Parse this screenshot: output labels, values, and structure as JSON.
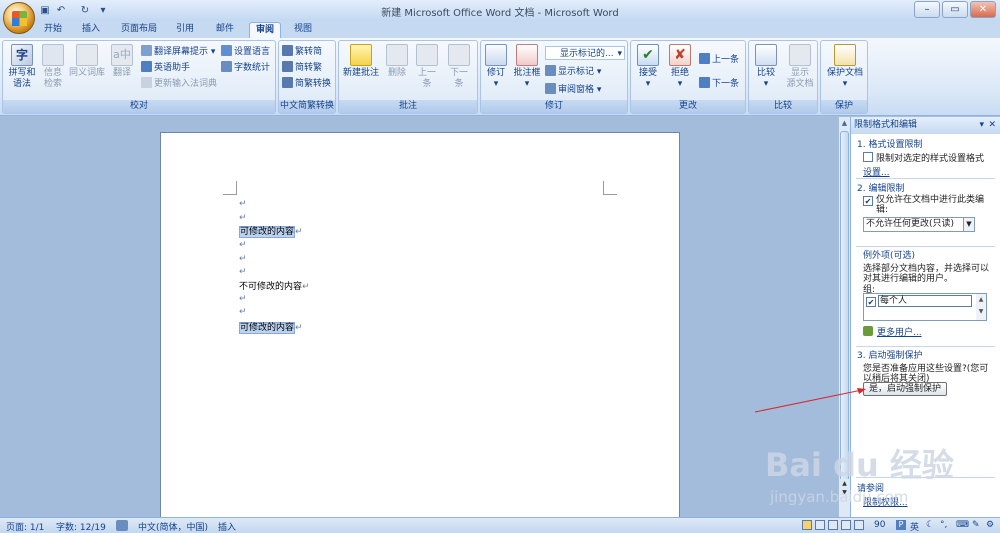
{
  "window": {
    "title": "新建 Microsoft Office Word 文档 - Microsoft Word",
    "qat_icons": [
      "save-icon",
      "undo-icon",
      "redo-icon",
      "customize-icon"
    ],
    "controls": [
      "minimize",
      "maximize",
      "close"
    ]
  },
  "tabs": [
    {
      "label": "开始"
    },
    {
      "label": "插入"
    },
    {
      "label": "页面布局"
    },
    {
      "label": "引用"
    },
    {
      "label": "邮件"
    },
    {
      "label": "审阅",
      "active": true
    },
    {
      "label": "视图"
    }
  ],
  "ribbon": {
    "proofing": {
      "label": "校对",
      "spelling": "拼写和\n语法",
      "research": "信息\n检索",
      "thesaurus": "同义词库",
      "translate": "翻译",
      "translate_tip": "翻译屏幕提示",
      "english_assistant": "英语助手",
      "update_ime": "更新输入法词典",
      "set_language": "设置语言",
      "word_count": "字数统计"
    },
    "chinese_conversion": {
      "label": "中文简繁转换",
      "to_simplified": "繁转简",
      "to_traditional": "简转繁",
      "convert": "简繁转换"
    },
    "comments": {
      "label": "批注",
      "new": "新建批注",
      "delete": "删除",
      "previous": "上一\n条",
      "next": "下一\n条"
    },
    "tracking": {
      "label": "修订",
      "track_changes": "修订",
      "balloons": "批注框",
      "display_mode": "显示标记的...",
      "show_markup": "显示标记",
      "reviewing_pane": "审阅窗格"
    },
    "changes": {
      "label": "更改",
      "accept": "接受",
      "reject": "拒绝",
      "previous": "上一条",
      "next": "下一条"
    },
    "compare": {
      "label": "比较",
      "compare": "比较",
      "show_source": "显示\n源文档"
    },
    "protect": {
      "label": "保护",
      "protect_document": "保护文档"
    }
  },
  "document": {
    "para_mark": "↵",
    "editable_1": "可修改的内容",
    "locked": "不可修改的内容",
    "editable_2": "可修改的内容"
  },
  "task_pane": {
    "title": "限制格式和编辑",
    "section1_title": "1. 格式设置限制",
    "section1_check": "限制对选定的样式设置格式",
    "section1_link": "设置...",
    "section2_title": "2. 编辑限制",
    "section2_check": "仅允许在文档中进行此类编辑:",
    "section2_check_line2": "辑:",
    "edit_mode_value": "不允许任何更改(只读)",
    "exceptions_title": "例外项(可选)",
    "exceptions_desc1": "选择部分文档内容，并选择可以",
    "exceptions_desc2": "对其进行编辑的用户。",
    "groups_label": "组:",
    "group_everyone": "每个人",
    "more_users": "更多用户...",
    "section3_title": "3. 启动强制保护",
    "section3_desc1": "您是否准备应用这些设置?(您可",
    "section3_desc2": "以稍后将其关闭)",
    "start_button": "是，启动强制保护",
    "see_also": "请参阅",
    "restrict_permission": "限制权限..."
  },
  "status_bar": {
    "page": "页面: 1/1",
    "words": "字数: 12/19",
    "language": "中文(简体，中国)",
    "mode": "插入",
    "zoom": "90",
    "ime": "英"
  },
  "watermark": {
    "brand": "Bai du 经验",
    "url": "jingyan.baidu.com"
  },
  "colors": {
    "accent": "#15428b",
    "ribbon_bg": "#dbe8f7",
    "selection": "#bcd2ee",
    "arrow": "#d6282a"
  }
}
